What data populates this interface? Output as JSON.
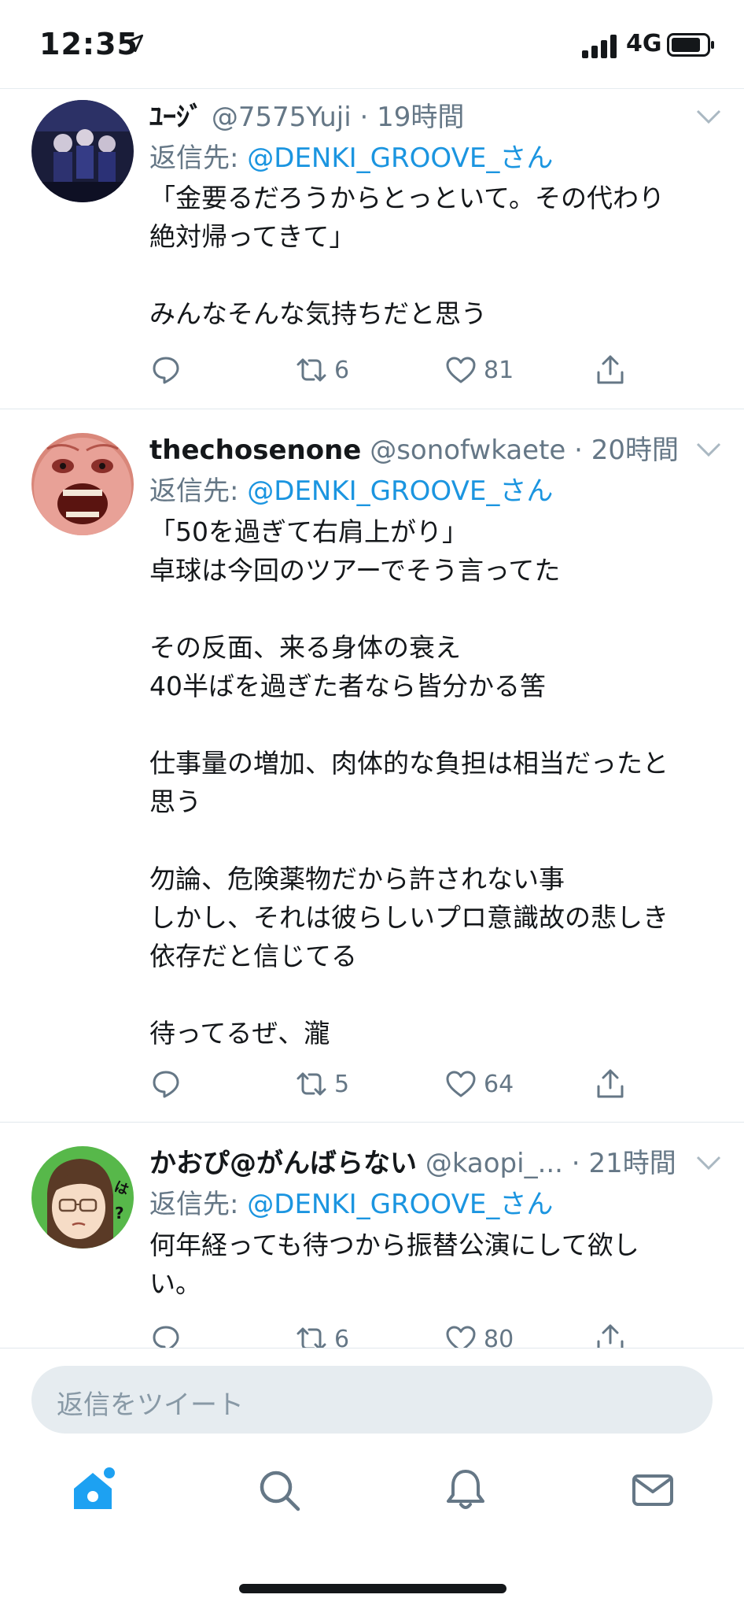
{
  "status_bar": {
    "time": "12:35",
    "network": "4G"
  },
  "tweets": [
    {
      "name": "ﾕｰｼﾞ",
      "handle": "@7575Yuji",
      "time": "19時間",
      "reply_prefix": "返信先: ",
      "reply_to": "@DENKI_GROOVE_さん",
      "body": [
        "「金要るだろうからとっといて。その代わり",
        "絶対帰ってきて」",
        "",
        "みんなそんな気持ちだと思う"
      ],
      "retweets": "6",
      "likes": "81"
    },
    {
      "name": "thechosenone",
      "handle": "@sonofwkaete",
      "time": "20時間",
      "reply_prefix": "返信先: ",
      "reply_to": "@DENKI_GROOVE_さん",
      "body": [
        "「50を過ぎて右肩上がり」",
        "卓球は今回のツアーでそう言ってた",
        "",
        "その反面、来る身体の衰え",
        "40半ばを過ぎた者なら皆分かる筈",
        "",
        "仕事量の増加、肉体的な負担は相当だったと",
        "思う",
        "",
        "勿論、危険薬物だから許されない事",
        "しかし、それは彼らしいプロ意識故の悲しき",
        "依存だと信じてる",
        "",
        "待ってるぜ、瀧"
      ],
      "retweets": "5",
      "likes": "64"
    },
    {
      "name": "かおぴ@がんばらない",
      "handle": "@kaopi_...",
      "time": "21時間",
      "reply_prefix": "返信先: ",
      "reply_to": "@DENKI_GROOVE_さん",
      "body": [
        "何年経っても待つから振替公演にして欲し",
        "い。"
      ],
      "retweets": "6",
      "likes": "80"
    }
  ],
  "composer": {
    "placeholder": "返信をツイート"
  },
  "colors": {
    "accent": "#1da1f2",
    "mention": "#1b95e0",
    "secondary_text": "#657786"
  },
  "icons": [
    "location-arrow-icon",
    "signal-icon",
    "battery-icon",
    "chevron-down-icon",
    "reply-icon",
    "retweet-icon",
    "like-icon",
    "share-icon",
    "home-icon",
    "search-icon",
    "bell-icon",
    "mail-icon"
  ]
}
